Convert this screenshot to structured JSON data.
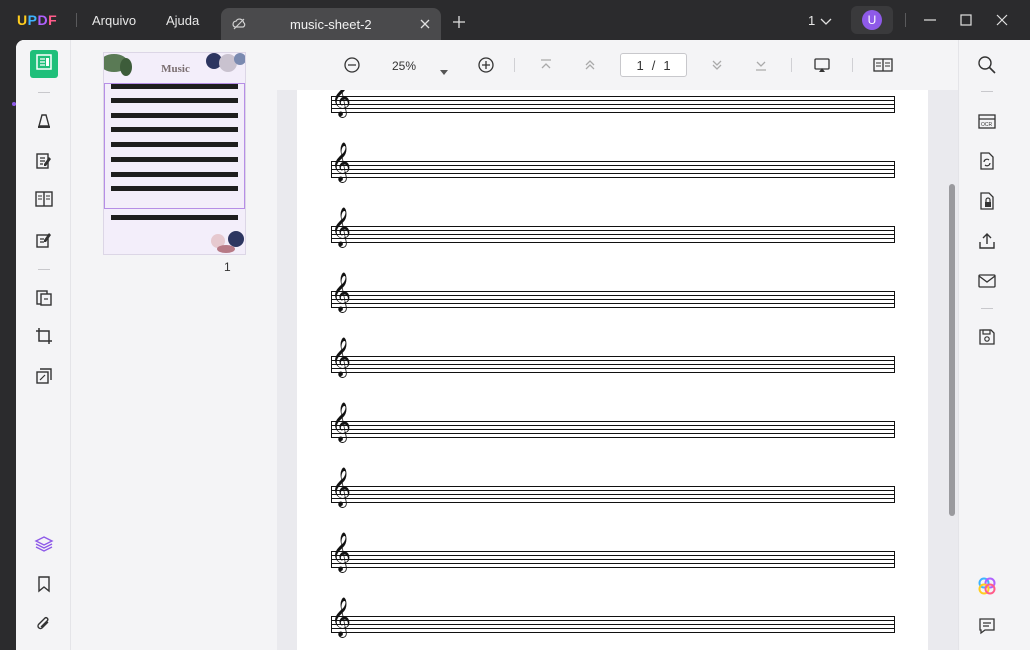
{
  "app": {
    "logo": "UPDF",
    "menus": [
      "Arquivo",
      "Ajuda"
    ],
    "tab_title": "music-sheet-2",
    "window_count": "1",
    "avatar_initial": "U",
    "accent_color": "#8e5ae8"
  },
  "thumbnail": {
    "title": "Music",
    "page_number": "1"
  },
  "viewer": {
    "zoom": "25%",
    "current_page": "1",
    "page_separator": "/",
    "total_pages": "1"
  },
  "document": {
    "staff_count": 9,
    "clef_glyph": "𝄞"
  },
  "icons": {
    "left_toolbar": [
      "reader-icon",
      "comment-icon",
      "edit-text-icon",
      "organize-pages-icon",
      "fill-sign-icon",
      "convert-icon",
      "crop-icon",
      "compress-icon",
      "layers-icon",
      "bookmark-icon",
      "attachment-icon"
    ],
    "right_toolbar": [
      "search-icon",
      "ocr-icon",
      "convert-pdf-icon",
      "protect-icon",
      "share-icon",
      "email-icon",
      "save-icon",
      "ai-icon",
      "comments-panel-icon"
    ]
  }
}
